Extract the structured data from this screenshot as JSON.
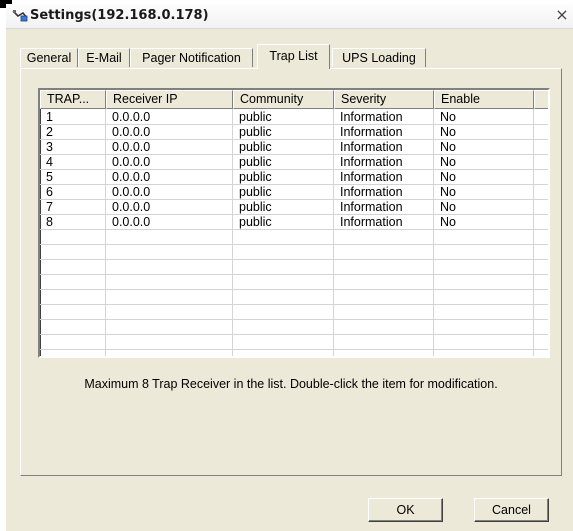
{
  "window": {
    "title": "Settings(192.168.0.178)",
    "close_glyph": "×",
    "icon": "network-cable-icon"
  },
  "tabs": [
    {
      "label": "General",
      "active": false
    },
    {
      "label": "E-Mail",
      "active": false
    },
    {
      "label": "Pager Notification",
      "active": false
    },
    {
      "label": "Trap List",
      "active": true
    },
    {
      "label": "UPS Loading",
      "active": false
    }
  ],
  "table": {
    "columns": [
      "TRAP...",
      "Receiver IP",
      "Community",
      "Severity",
      "Enable"
    ],
    "rows": [
      [
        "1",
        "0.0.0.0",
        "public",
        "Information",
        "No"
      ],
      [
        "2",
        "0.0.0.0",
        "public",
        "Information",
        "No"
      ],
      [
        "3",
        "0.0.0.0",
        "public",
        "Information",
        "No"
      ],
      [
        "4",
        "0.0.0.0",
        "public",
        "Information",
        "No"
      ],
      [
        "5",
        "0.0.0.0",
        "public",
        "Information",
        "No"
      ],
      [
        "6",
        "0.0.0.0",
        "public",
        "Information",
        "No"
      ],
      [
        "7",
        "0.0.0.0",
        "public",
        "Information",
        "No"
      ],
      [
        "8",
        "0.0.0.0",
        "public",
        "Information",
        "No"
      ]
    ]
  },
  "hint": "Maximum 8 Trap Receiver in the list. Double-click the item for modification.",
  "buttons": {
    "ok": "OK",
    "cancel": "Cancel"
  }
}
